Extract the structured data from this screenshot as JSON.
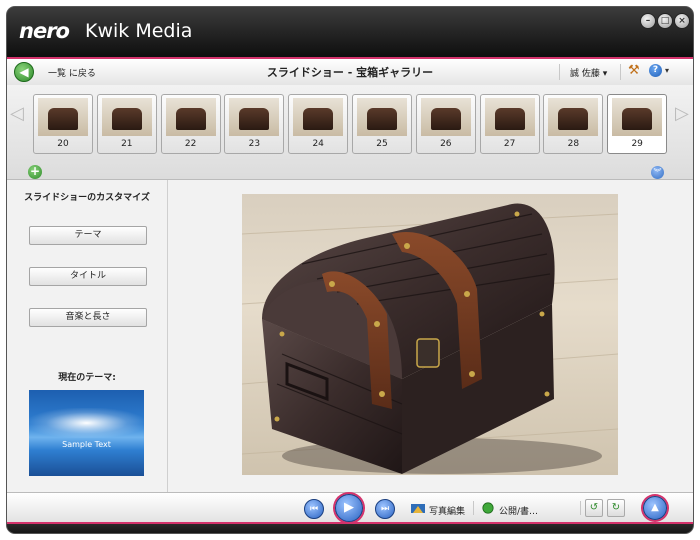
{
  "window": {
    "logo_text": "nero",
    "app_name": "Kwik Media",
    "minimize_glyph": "–",
    "maximize_glyph": "□",
    "close_glyph": "×"
  },
  "header": {
    "back_label": "一覧 に戻る",
    "page_title": "スライドショー - 宝箱ギャラリー",
    "user_label": "誠 佐藤 ▾",
    "help_glyph": "?",
    "help_dropdown": "▾"
  },
  "strip": {
    "prev_glyph": "◁",
    "next_glyph": "▷",
    "add_glyph": "+",
    "expand_glyph": "︾",
    "thumbnails": [
      {
        "number": "20",
        "selected": false
      },
      {
        "number": "21",
        "selected": false
      },
      {
        "number": "22",
        "selected": false
      },
      {
        "number": "23",
        "selected": false
      },
      {
        "number": "24",
        "selected": false
      },
      {
        "number": "25",
        "selected": false
      },
      {
        "number": "26",
        "selected": false
      },
      {
        "number": "27",
        "selected": false
      },
      {
        "number": "28",
        "selected": false
      },
      {
        "number": "29",
        "selected": true
      }
    ]
  },
  "left_panel": {
    "title": "スライドショーのカスタマイズ",
    "theme_button": "テーマ",
    "title_button": "タイトル",
    "music_button": "音楽と長さ",
    "current_theme_label": "現在のテーマ:",
    "theme_preview_text": "Sample Text"
  },
  "bottom": {
    "first_glyph": "⏮",
    "play_glyph": "▶",
    "last_glyph": "⏭",
    "photo_edit_label": "写真編集",
    "publish_label": "公開/書…",
    "upload_glyph": "▲"
  },
  "colors": {
    "accent": "#d4336c",
    "green_button": "#2d8a2a",
    "blue_button": "#2a63c2"
  }
}
